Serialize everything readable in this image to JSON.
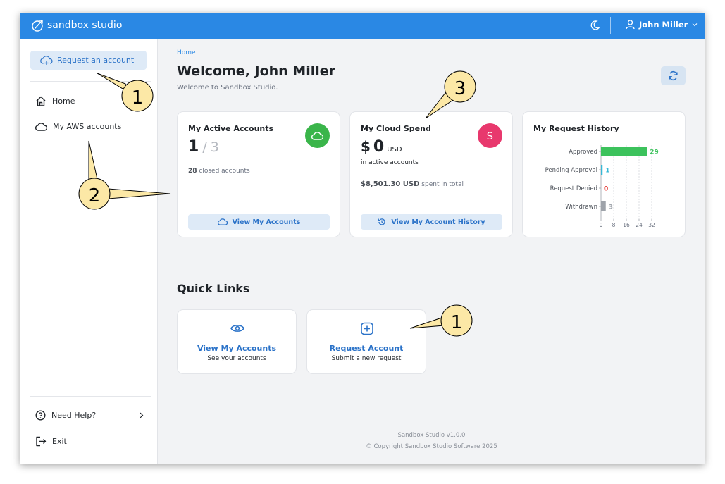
{
  "topbar": {
    "brand": "sandbox studio",
    "user_name": "John Miller"
  },
  "sidebar": {
    "request_button": "Request an account",
    "items": [
      {
        "label": "Home"
      },
      {
        "label": "My AWS accounts"
      }
    ],
    "bottom_items": [
      {
        "label": "Need Help?"
      },
      {
        "label": "Exit"
      }
    ]
  },
  "main": {
    "breadcrumb": "Home",
    "title": "Welcome, John Miller",
    "subtitle": "Welcome to Sandbox Studio."
  },
  "cards": {
    "active": {
      "title": "My Active Accounts",
      "count": "1",
      "separator": "/",
      "total": "3",
      "closed_count": "28",
      "closed_label": "closed accounts",
      "button": "View My Accounts",
      "badge_color": "#3ab54a"
    },
    "spend": {
      "title": "My Cloud Spend",
      "currency_symbol": "$",
      "amount": "0",
      "unit": "USD",
      "caption": "in active accounts",
      "total_amount": "$8,501.30 USD",
      "total_label": "spent in total",
      "button": "View My Account History",
      "badge_color": "#e8386d"
    },
    "history": {
      "title": "My Request History"
    }
  },
  "chart_data": {
    "type": "bar",
    "orientation": "horizontal",
    "title": "My Request History",
    "categories": [
      "Approved",
      "Pending Approval",
      "Request Denied",
      "Withdrawn"
    ],
    "values": [
      29,
      1,
      0,
      3
    ],
    "colors": [
      "#3cc25c",
      "#36b8d6",
      "#e53935",
      "#9ea3aa"
    ],
    "xticks": [
      "0",
      "8",
      "16",
      "24",
      "32"
    ],
    "xlim": [
      0,
      32
    ],
    "grid": true
  },
  "quick_links": {
    "title": "Quick Links",
    "items": [
      {
        "title": "View My Accounts",
        "desc": "See your accounts",
        "icon": "eye-icon"
      },
      {
        "title": "Request Account",
        "desc": "Submit a new request",
        "icon": "plus-square-icon"
      }
    ]
  },
  "footer": {
    "version": "Sandbox Studio v1.0.0",
    "copyright": "© Copyright Sandbox Studio Software 2025"
  },
  "callouts": [
    "1",
    "2",
    "3",
    "1"
  ],
  "colors": {
    "primary": "#2a88e4",
    "link": "#2a72c8",
    "callout_fill": "#fce8a6"
  }
}
